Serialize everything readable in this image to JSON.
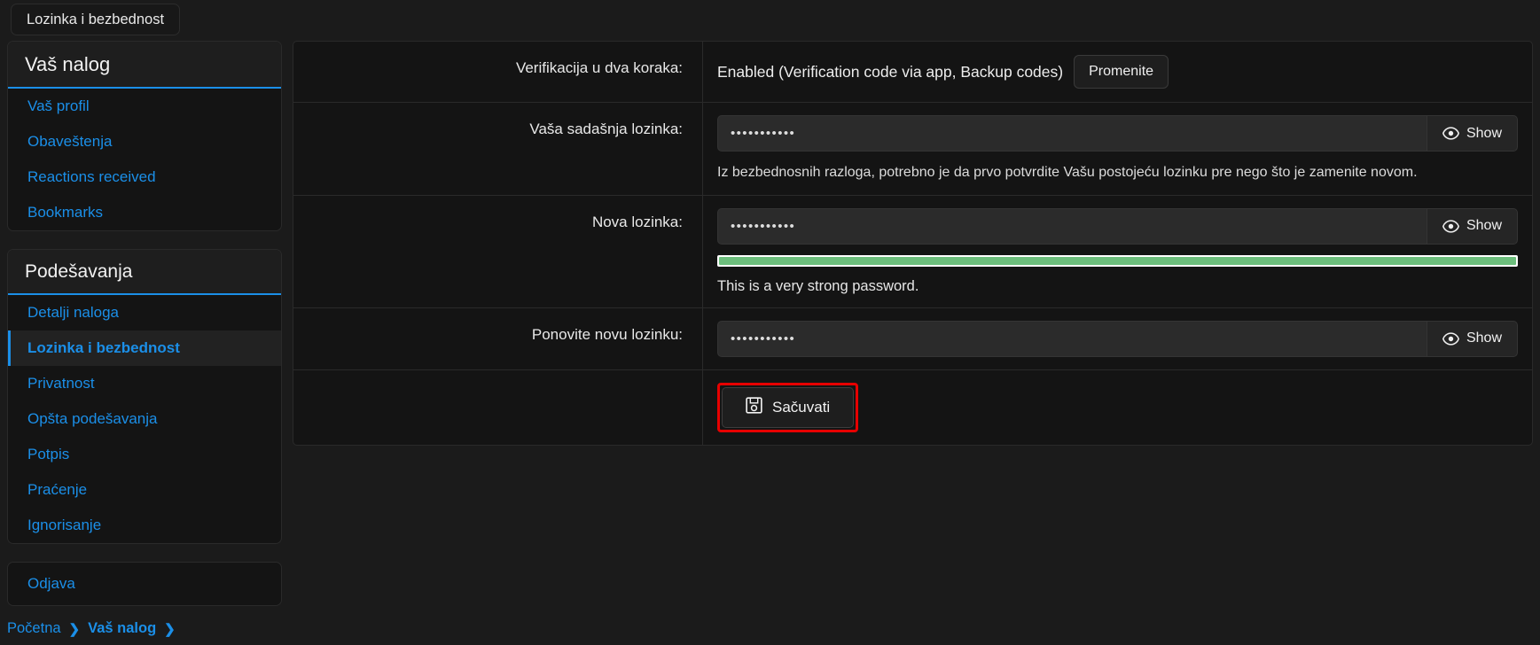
{
  "window": {
    "tab_label": "Lozinka i bezbednost"
  },
  "sidebar": {
    "account_panel": {
      "title": "Vaš nalog",
      "items": [
        {
          "label": "Vaš profil",
          "active": false
        },
        {
          "label": "Obaveštenja",
          "active": false
        },
        {
          "label": "Reactions received",
          "active": false
        },
        {
          "label": "Bookmarks",
          "active": false
        }
      ]
    },
    "settings_panel": {
      "title": "Podešavanja",
      "items": [
        {
          "label": "Detalji naloga",
          "active": false
        },
        {
          "label": "Lozinka i bezbednost",
          "active": true
        },
        {
          "label": "Privatnost",
          "active": false
        },
        {
          "label": "Opšta podešavanja",
          "active": false
        },
        {
          "label": "Potpis",
          "active": false
        },
        {
          "label": "Praćenje",
          "active": false
        },
        {
          "label": "Ignorisanje",
          "active": false
        }
      ]
    },
    "logout": {
      "label": "Odjava"
    }
  },
  "breadcrumb": {
    "items": [
      {
        "label": "Početna",
        "current": false
      },
      {
        "label": "Vaš nalog",
        "current": true
      }
    ],
    "separator": "❯"
  },
  "form": {
    "two_factor": {
      "label": "Verifikacija u dva koraka:",
      "value": "Enabled (Verification code via app, Backup codes)",
      "change_button": "Promenite"
    },
    "current_password": {
      "label": "Vaša sadašnja lozinka:",
      "value": "•••••••••••",
      "placeholder": "",
      "show_button": "Show",
      "help": "Iz bezbednosnih razloga, potrebno je da prvo potvrdite Vašu postojeću lozinku pre nego što je zamenite novom."
    },
    "new_password": {
      "label": "Nova lozinka:",
      "value": "•••••••••••",
      "placeholder": "",
      "show_button": "Show",
      "strength_percent": 100,
      "strength_message": "This is a very strong password.",
      "strength_color": "#6cbe7c"
    },
    "confirm_password": {
      "label": "Ponovite novu lozinku:",
      "value": "•••••••••••",
      "placeholder": "",
      "show_button": "Show"
    },
    "save": {
      "label": "Sačuvati",
      "icon": "save-floppy-icon",
      "highlight_color": "#e60000"
    }
  },
  "colors": {
    "accent": "#1b8fe8",
    "page_bg": "#1b1b1b",
    "panel_bg": "#141414"
  }
}
